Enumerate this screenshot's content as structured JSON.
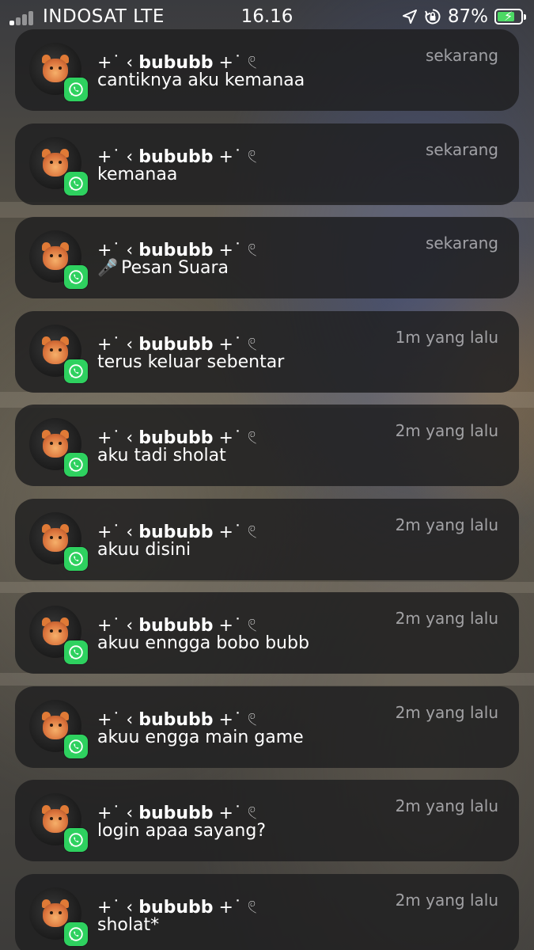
{
  "status_bar": {
    "carrier": "INDOSAT  LTE",
    "time": "16.16",
    "battery_percent": "87%",
    "battery_level": 0.87,
    "icons": [
      "signal-icon",
      "location-arrow-icon",
      "rotation-lock-icon",
      "battery-charging-icon"
    ]
  },
  "notifications": [
    {
      "sender": "bububb",
      "deco_left": "+˙ ‹ ",
      "deco_right": " +˙ 𓏲",
      "time": "sekarang",
      "message": "cantiknya aku kemanaa",
      "voice": false
    },
    {
      "sender": "bububb",
      "deco_left": "+˙ ‹ ",
      "deco_right": " +˙ 𓏲",
      "time": "sekarang",
      "message": "kemanaa",
      "voice": false
    },
    {
      "sender": "bububb",
      "deco_left": "+˙ ‹ ",
      "deco_right": " +˙ 𓏲",
      "time": "sekarang",
      "message": "Pesan Suara",
      "voice": true
    },
    {
      "sender": "bububb",
      "deco_left": "+˙ ‹ ",
      "deco_right": " +˙ 𓏲",
      "time": "1m yang lalu",
      "message": "terus keluar sebentar",
      "voice": false
    },
    {
      "sender": "bububb",
      "deco_left": "+˙ ‹ ",
      "deco_right": " +˙ 𓏲",
      "time": "2m yang lalu",
      "message": "aku tadi sholat",
      "voice": false
    },
    {
      "sender": "bububb",
      "deco_left": "+˙ ‹ ",
      "deco_right": " +˙ 𓏲",
      "time": "2m yang lalu",
      "message": "akuu disini",
      "voice": false
    },
    {
      "sender": "bububb",
      "deco_left": "+˙ ‹ ",
      "deco_right": " +˙ 𓏲",
      "time": "2m yang lalu",
      "message": "akuu enngga bobo bubb",
      "voice": false
    },
    {
      "sender": "bububb",
      "deco_left": "+˙ ‹ ",
      "deco_right": " +˙ 𓏲",
      "time": "2m yang lalu",
      "message": "akuu engga main game",
      "voice": false
    },
    {
      "sender": "bububb",
      "deco_left": "+˙ ‹ ",
      "deco_right": " +˙ 𓏲",
      "time": "2m yang lalu",
      "message": "login apaa sayang?",
      "voice": false
    },
    {
      "sender": "bububb",
      "deco_left": "+˙ ‹ ",
      "deco_right": " +˙ 𓏲",
      "time": "2m yang lalu",
      "message": "sholat*",
      "voice": false
    }
  ],
  "colors": {
    "whatsapp_green": "#2ed15f",
    "battery_green": "#4cd964",
    "card_bg": "rgba(30,30,32,0.82)"
  }
}
